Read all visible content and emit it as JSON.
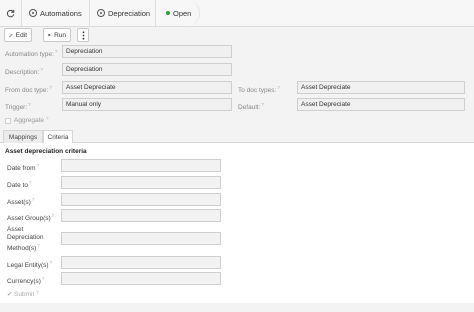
{
  "breadcrumb": {
    "items": [
      {
        "label": "Automations"
      },
      {
        "label": "Depreciation"
      },
      {
        "label": "Open"
      }
    ]
  },
  "toolbar": {
    "edit_label": "Edit",
    "run_label": "Run"
  },
  "form": {
    "automation_type": {
      "label": "Automation type:",
      "value": "Depreciation"
    },
    "description": {
      "label": "Description:",
      "value": "Depreciation"
    },
    "from_doc_type": {
      "label": "From doc type:",
      "value": "Asset Depreciate"
    },
    "to_doc_types": {
      "label": "To doc types:",
      "value": "Asset Depreciate"
    },
    "trigger": {
      "label": "Trigger:",
      "value": "Manual only"
    },
    "default": {
      "label": "Default:",
      "value": "Asset Depreciate"
    },
    "aggregate": {
      "label": "Aggregate"
    }
  },
  "tabs": [
    {
      "label": "Mappings"
    },
    {
      "label": "Criteria"
    }
  ],
  "criteria": {
    "title": "Asset depreciation criteria",
    "fields": [
      {
        "label": "Date from"
      },
      {
        "label": "Date to"
      },
      {
        "label": "Asset(s)"
      },
      {
        "label": "Asset Group(s)"
      },
      {
        "label": "Asset Depreciation Method(s)"
      },
      {
        "label": "Legal Entity(s)"
      },
      {
        "label": "Currency(s)"
      }
    ],
    "submit_label": "Submit"
  },
  "colors": {
    "open_status": "#2e9e3e"
  }
}
